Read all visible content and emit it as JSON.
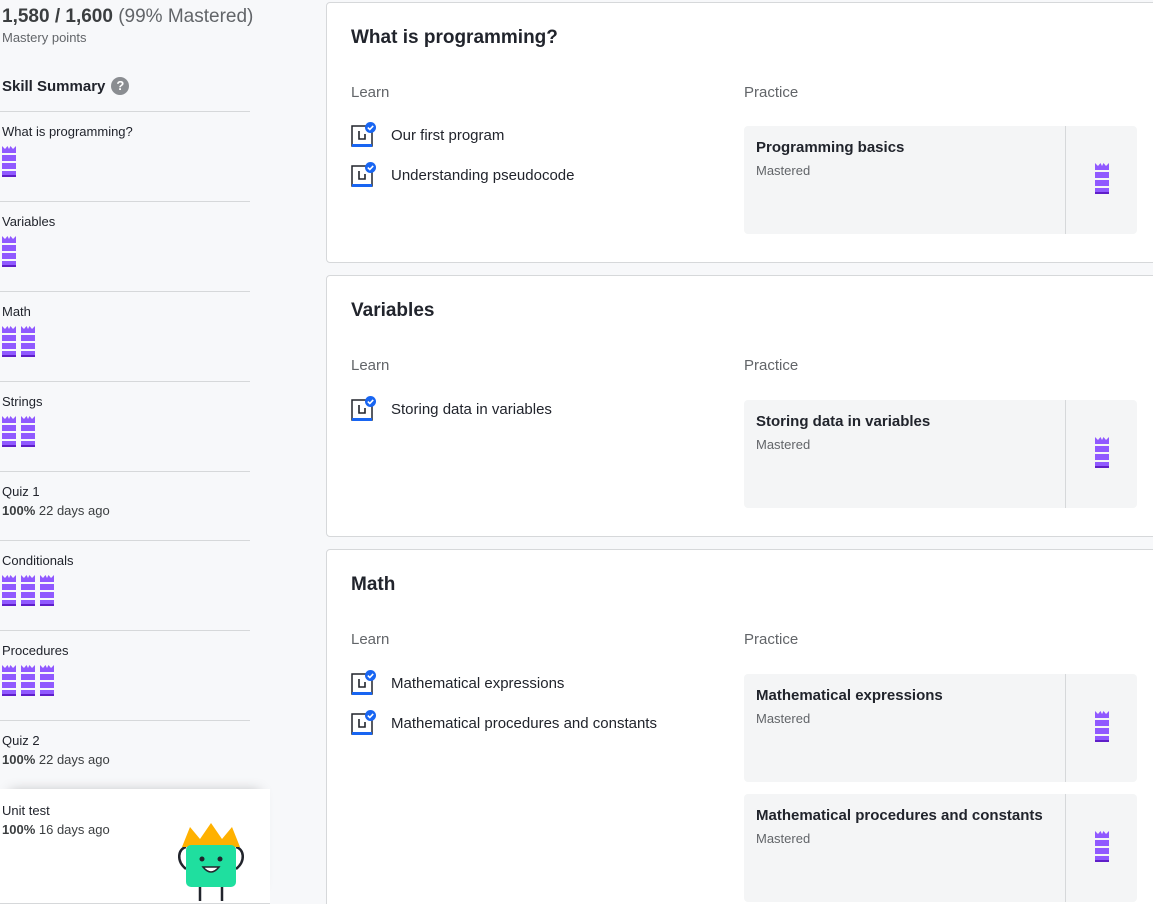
{
  "sidebar": {
    "points": "1,580 / 1,600",
    "points_pct": "(99% Mastered)",
    "points_label": "Mastery points",
    "summary_title": "Skill Summary",
    "help_glyph": "?",
    "items": [
      {
        "label": "What is programming?",
        "towers": 1
      },
      {
        "label": "Variables",
        "towers": 1
      },
      {
        "label": "Math",
        "towers": 2
      },
      {
        "label": "Strings",
        "towers": 2
      },
      {
        "label": "Quiz 1",
        "score_pct": "100%",
        "score_when": "22 days ago"
      },
      {
        "label": "Conditionals",
        "towers": 3
      },
      {
        "label": "Procedures",
        "towers": 3
      },
      {
        "label": "Quiz 2",
        "score_pct": "100%",
        "score_when": "22 days ago"
      }
    ],
    "unit_test": {
      "label": "Unit test",
      "score_pct": "100%",
      "score_when": "16 days ago"
    }
  },
  "cards": [
    {
      "title": "What is programming?",
      "learn_label": "Learn",
      "practice_label": "Practice",
      "learn_items": [
        "Our first program",
        "Understanding pseudocode"
      ],
      "practice": [
        {
          "title": "Programming basics",
          "status": "Mastered"
        }
      ]
    },
    {
      "title": "Variables",
      "learn_label": "Learn",
      "practice_label": "Practice",
      "learn_items": [
        "Storing data in variables"
      ],
      "practice": [
        {
          "title": "Storing data in variables",
          "status": "Mastered"
        }
      ]
    },
    {
      "title": "Math",
      "learn_label": "Learn",
      "practice_label": "Practice",
      "learn_items": [
        "Mathematical expressions",
        "Mathematical procedures and constants"
      ],
      "practice": [
        {
          "title": "Mathematical expressions",
          "status": "Mastered"
        },
        {
          "title": "Mathematical procedures and constants",
          "status": "Mastered"
        }
      ]
    }
  ],
  "colors": {
    "mastery_purple": "#9059ff",
    "mastery_dark": "#5f1ec9",
    "check_blue": "#1865f2",
    "mascot_green": "#1fdf9f",
    "crown_gold": "#ffb100"
  },
  "icons": {
    "help": "help-circle-icon",
    "learn": "article-icon",
    "mastery": "mastered-tower-icon",
    "mascot": "mascot-icon"
  }
}
